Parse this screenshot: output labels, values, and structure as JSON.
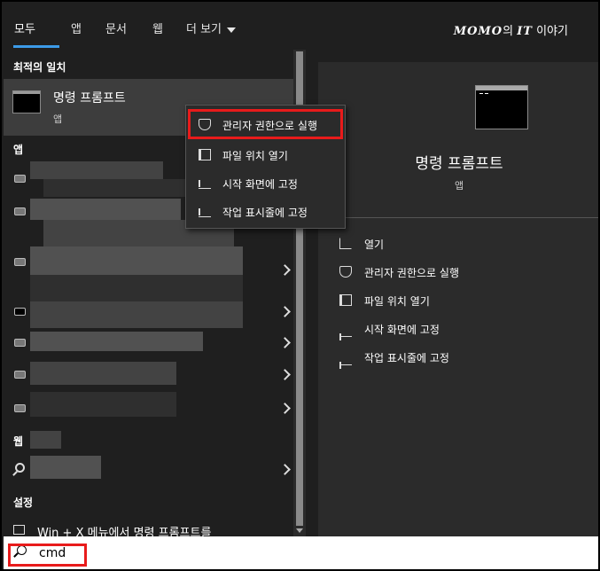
{
  "tabs": [
    {
      "label": "모두",
      "active": true
    },
    {
      "label": "앱"
    },
    {
      "label": "문서"
    },
    {
      "label": "웹"
    },
    {
      "label": "더 보기"
    }
  ],
  "brand": {
    "bold": "MOMO",
    "mid": "의 ",
    "bold2": "IT",
    "rest": " 이야기"
  },
  "left": {
    "best_match_header": "최적의 일치",
    "best_match": {
      "title": "명령 프롬프트",
      "subtitle": "앱",
      "icon": "command-prompt-icon"
    },
    "apps_header": "앱",
    "web_header": "웹",
    "settings_header": "설정",
    "settings_item": "Win + X 메뉴에서 명령 프롬프트를"
  },
  "context_menu": [
    {
      "label": "관리자 권한으로 실행",
      "icon": "shield-icon"
    },
    {
      "label": "파일 위치 열기",
      "icon": "folder-icon"
    },
    {
      "label": "시작 화면에 고정",
      "icon": "pin-icon"
    },
    {
      "label": "작업 표시줄에 고정",
      "icon": "pin-icon"
    }
  ],
  "right": {
    "title": "명령 프롬프트",
    "subtitle": "앱",
    "actions": [
      {
        "label": "열기",
        "icon": "open-icon"
      },
      {
        "label": "관리자 권한으로 실행",
        "icon": "shield-icon"
      },
      {
        "label": "파일 위치 열기",
        "icon": "folder-icon"
      },
      {
        "label": "시작 화면에 고정",
        "icon": "pin-icon"
      },
      {
        "label": "작업 표시줄에 고정",
        "icon": "pin-icon"
      }
    ]
  },
  "search": {
    "query": "cmd"
  },
  "colors": {
    "accent": "#3c9be8",
    "highlight": "#e81b1b",
    "panel": "#2b2b2b",
    "bg": "#1f1f1f"
  }
}
